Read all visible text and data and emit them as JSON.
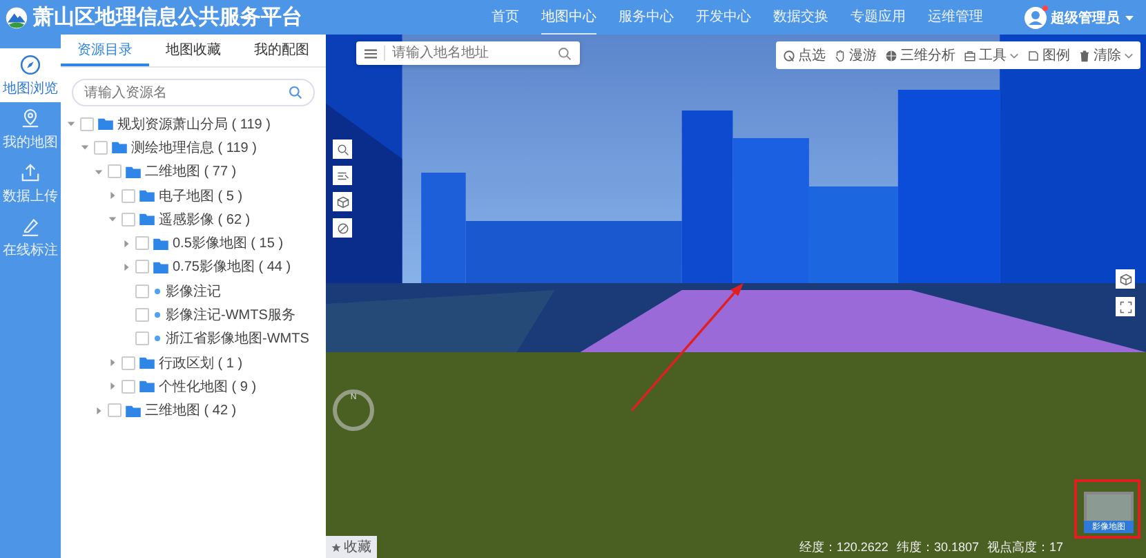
{
  "header": {
    "title": "萧山区地理信息公共服务平台",
    "nav": [
      {
        "label": "首页",
        "selected": false
      },
      {
        "label": "地图中心",
        "selected": true
      },
      {
        "label": "服务中心",
        "selected": false
      },
      {
        "label": "开发中心",
        "selected": false
      },
      {
        "label": "数据交换",
        "selected": false
      },
      {
        "label": "专题应用",
        "selected": false
      },
      {
        "label": "运维管理",
        "selected": false
      }
    ],
    "user": {
      "name": "超级管理员",
      "notification": true
    }
  },
  "sidebar": {
    "items": [
      {
        "label": "地图浏览",
        "selected": true
      },
      {
        "label": "我的地图",
        "selected": false
      },
      {
        "label": "数据上传",
        "selected": false
      },
      {
        "label": "在线标注",
        "selected": false
      }
    ]
  },
  "panel": {
    "tabs": [
      {
        "label": "资源目录",
        "selected": true
      },
      {
        "label": "地图收藏",
        "selected": false
      },
      {
        "label": "我的配图",
        "selected": false
      }
    ],
    "search": {
      "placeholder": "请输入资源名"
    },
    "tree": [
      {
        "label": "规划资源萧山分局 ( 119 )",
        "kind": "folder",
        "expanded": true,
        "checked": false,
        "children": [
          {
            "label": "测绘地理信息 ( 119 )",
            "kind": "folder",
            "expanded": true,
            "checked": false,
            "children": [
              {
                "label": "二维地图 ( 77 )",
                "kind": "folder",
                "expanded": true,
                "checked": false,
                "children": [
                  {
                    "label": "电子地图 ( 5 )",
                    "kind": "folder",
                    "expanded": false,
                    "checked": false
                  },
                  {
                    "label": "遥感影像 ( 62 )",
                    "kind": "folder",
                    "expanded": true,
                    "checked": false,
                    "children": [
                      {
                        "label": "0.5影像地图 ( 15 )",
                        "kind": "folder",
                        "expanded": false,
                        "checked": false
                      },
                      {
                        "label": "0.75影像地图 ( 44 )",
                        "kind": "folder",
                        "expanded": false,
                        "checked": false
                      },
                      {
                        "label": "影像注记",
                        "kind": "layer",
                        "checked": false
                      },
                      {
                        "label": "影像注记-WMTS服务",
                        "kind": "layer",
                        "checked": false
                      },
                      {
                        "label": "浙江省影像地图-WMTS",
                        "kind": "layer",
                        "checked": false
                      }
                    ]
                  },
                  {
                    "label": "行政区划 ( 1 )",
                    "kind": "folder",
                    "expanded": false,
                    "checked": false
                  },
                  {
                    "label": "个性化地图 ( 9 )",
                    "kind": "folder",
                    "expanded": false,
                    "checked": false
                  }
                ]
              },
              {
                "label": "三维地图 ( 42 )",
                "kind": "folder",
                "expanded": false,
                "checked": false
              }
            ]
          }
        ]
      }
    ]
  },
  "map": {
    "search": {
      "placeholder": "请输入地名地址"
    },
    "toolbar": [
      {
        "label": "点选",
        "dropdown": false
      },
      {
        "label": "漫游",
        "dropdown": false
      },
      {
        "label": "三维分析",
        "dropdown": false
      },
      {
        "label": "工具",
        "dropdown": true
      },
      {
        "label": "图例",
        "dropdown": false
      },
      {
        "label": "清除",
        "dropdown": true
      }
    ],
    "compass": "N",
    "favorite": "收藏",
    "basemap": "影像地图",
    "status": [
      "经度：120.2622",
      "纬度：30.1807",
      "视点高度：17"
    ]
  }
}
